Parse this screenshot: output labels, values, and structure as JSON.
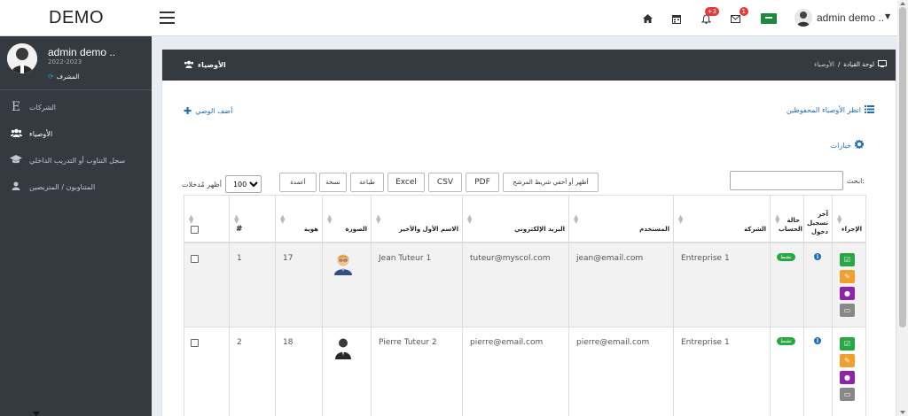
{
  "brand": "DEMO",
  "topbar": {
    "badges": {
      "notifications": "+3",
      "messages": "1"
    },
    "user_name": "admin demo ..",
    "icons": [
      "home-icon",
      "calendar-icon",
      "bell-icon",
      "envelope-icon",
      "flag-icon"
    ]
  },
  "sidebar": {
    "user": {
      "name": "admin demo ..",
      "year": "2022-2023",
      "role": "المشرف"
    },
    "items": [
      {
        "label": "الشركات",
        "icon": "letter-e-icon"
      },
      {
        "label": "الأوصياء",
        "icon": "users-icon",
        "active": true
      },
      {
        "label": "سجل التناوب أو التدريب الداخلي",
        "icon": "graduation-cap-icon"
      },
      {
        "label": "المتناوبون / المتربصين",
        "icon": "user-icon"
      }
    ]
  },
  "card": {
    "title": "الأوصياء",
    "breadcrumb": {
      "home": "لوحة القيادة",
      "current": "الأوصياء",
      "separator": "/"
    }
  },
  "actions": {
    "add": "أضف الوصي",
    "saved": "انظر الأوصياء المحفوظين",
    "options": "خيارات"
  },
  "datatable": {
    "length_label": "أظهر مُدخلات",
    "length_value": "100",
    "buttons": {
      "columns": "أعمدة",
      "copy": "نسخة",
      "print": "طباعة",
      "excel": "Excel",
      "csv": "CSV",
      "pdf": "PDF",
      "toggle_filter": "أظهر أو أخفي شريط المرشح"
    },
    "search_label": "ابحث:"
  },
  "table": {
    "headers": {
      "hash": "#",
      "id": "هوية",
      "photo": "الصورة",
      "name": "الاسم الأول والأخير",
      "email": "البريد الإلكتروني",
      "user": "المستخدم",
      "company": "الشركة",
      "status": "حالة الحساب",
      "last_login": "آخر تسجيل دخول",
      "action": "الإجراء"
    },
    "rows": [
      {
        "num": "1",
        "id": "17",
        "name": "Jean Tuteur 1",
        "email": "tuteur@myscol.com",
        "user": "jean@email.com",
        "company": "Entreprise 1",
        "status": "نشط"
      },
      {
        "num": "2",
        "id": "18",
        "name": "Pierre Tuteur 2",
        "email": "pierre@email.com",
        "user": "pierre@email.com",
        "company": "Entreprise 1",
        "status": "نشط"
      }
    ]
  },
  "colors": {
    "sidebar_bg": "#343a40",
    "link": "#1f6fb8",
    "status_active": "#28a745",
    "badge": "#e53935"
  }
}
